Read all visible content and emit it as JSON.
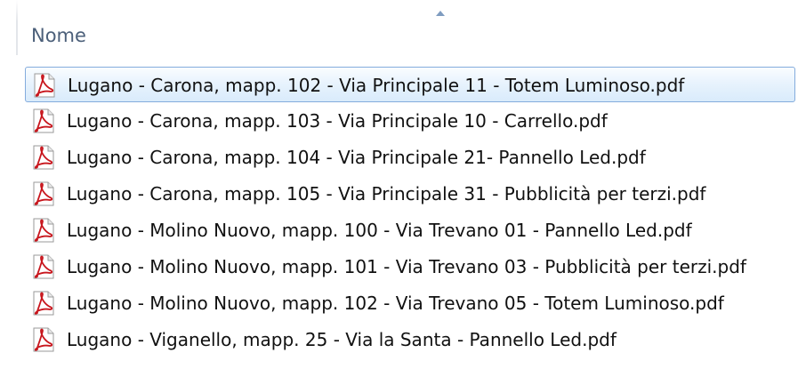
{
  "column": {
    "name_label": "Nome",
    "sort_direction": "ascending"
  },
  "files": [
    {
      "name": "Lugano - Carona, mapp. 102 - Via Principale 11 - Totem Luminoso.pdf",
      "icon": "pdf-file-icon",
      "selected": true
    },
    {
      "name": "Lugano - Carona, mapp. 103  - Via Principale 10 - Carrello.pdf",
      "icon": "pdf-file-icon",
      "selected": false
    },
    {
      "name": "Lugano - Carona, mapp. 104  - Via Principale 21- Pannello Led.pdf",
      "icon": "pdf-file-icon",
      "selected": false
    },
    {
      "name": "Lugano - Carona, mapp. 105 - Via Principale 31 - Pubblicità per terzi.pdf",
      "icon": "pdf-file-icon",
      "selected": false
    },
    {
      "name": "Lugano - Molino Nuovo, mapp. 100 - Via Trevano 01 - Pannello Led.pdf",
      "icon": "pdf-file-icon",
      "selected": false
    },
    {
      "name": "Lugano - Molino Nuovo, mapp. 101 - Via Trevano 03 - Pubblicità per terzi.pdf",
      "icon": "pdf-file-icon",
      "selected": false
    },
    {
      "name": "Lugano - Molino Nuovo, mapp. 102 - Via Trevano 05 - Totem Luminoso.pdf",
      "icon": "pdf-file-icon",
      "selected": false
    },
    {
      "name": "Lugano - Viganello, mapp. 25 - Via la Santa  - Pannello Led.pdf",
      "icon": "pdf-file-icon",
      "selected": false
    }
  ],
  "colors": {
    "selection_border": "#84acdd",
    "selection_fill": "#d9ebfb",
    "header_text": "#4c607a",
    "pdf_red": "#c8161d"
  }
}
